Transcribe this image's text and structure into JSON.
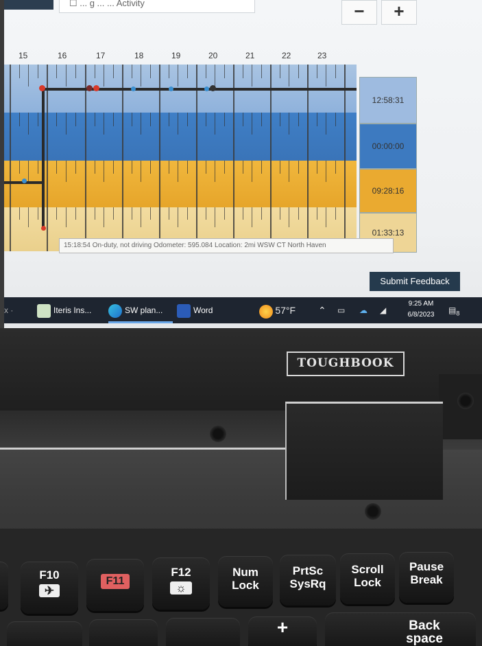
{
  "toolbar": {
    "field_text": "☐ ... g ... ... Activity",
    "minus_label": "−",
    "plus_label": "+"
  },
  "chart": {
    "hours": [
      "15",
      "16",
      "17",
      "18",
      "19",
      "20",
      "21",
      "22",
      "23"
    ],
    "totals": [
      "12:58:31",
      "00:00:00",
      "09:28:16",
      "01:33:13"
    ],
    "row_colors": [
      "#9ebbe0",
      "#3d7ac0",
      "#eaaa30",
      "#eed596"
    ],
    "tooltip": "15:18:54 On-duty, not driving Odometer: 595.084 Location: 2mi WSW CT North Haven"
  },
  "feedback_label": "Submit Feedback",
  "taskbar": {
    "items": [
      {
        "label": "Iteris Ins...",
        "icon": "iteris-icon"
      },
      {
        "label": "SW plan...",
        "icon": "edge-icon"
      },
      {
        "label": "Word",
        "icon": "word-icon"
      }
    ],
    "weather": "57°F",
    "time": "9:25 AM",
    "date": "6/8/2023",
    "notifications": "8"
  },
  "laptop": {
    "brand": "TOUGHBOOK"
  },
  "keyboard": {
    "keys": [
      {
        "top": "F10",
        "bottom": "✈"
      },
      {
        "top": "F11",
        "bottom": ""
      },
      {
        "top": "F12",
        "bottom": "☼"
      },
      {
        "top": "Num",
        "bottom": "Lock"
      },
      {
        "top": "PrtSc",
        "bottom": "SysRq"
      },
      {
        "top": "Scroll",
        "bottom": "Lock"
      },
      {
        "top": "Pause",
        "bottom": "Break"
      },
      {
        "top": "+",
        "bottom": ""
      },
      {
        "top": "Back",
        "bottom": "space"
      }
    ]
  }
}
